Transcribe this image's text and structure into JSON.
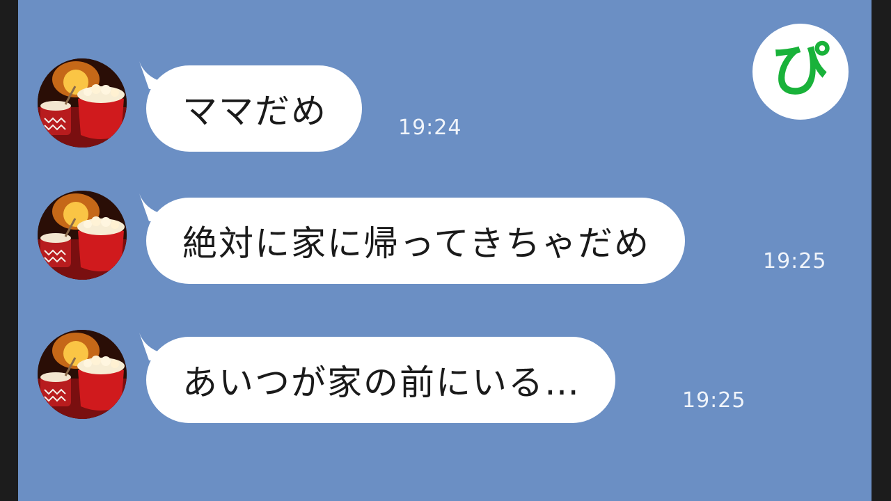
{
  "chat": {
    "background_color": "#6b8fc4",
    "messages": [
      {
        "text": "ママだめ",
        "time": "19:24",
        "avatar": "fireplace-popcorn-avatar"
      },
      {
        "text": "絶対に家に帰ってきちゃだめ",
        "time": "19:25",
        "avatar": "fireplace-popcorn-avatar"
      },
      {
        "text": "あいつが家の前にいる…",
        "time": "19:25",
        "avatar": "fireplace-popcorn-avatar"
      }
    ]
  },
  "logo": {
    "text": "ぴ",
    "color": "#19b23a"
  }
}
